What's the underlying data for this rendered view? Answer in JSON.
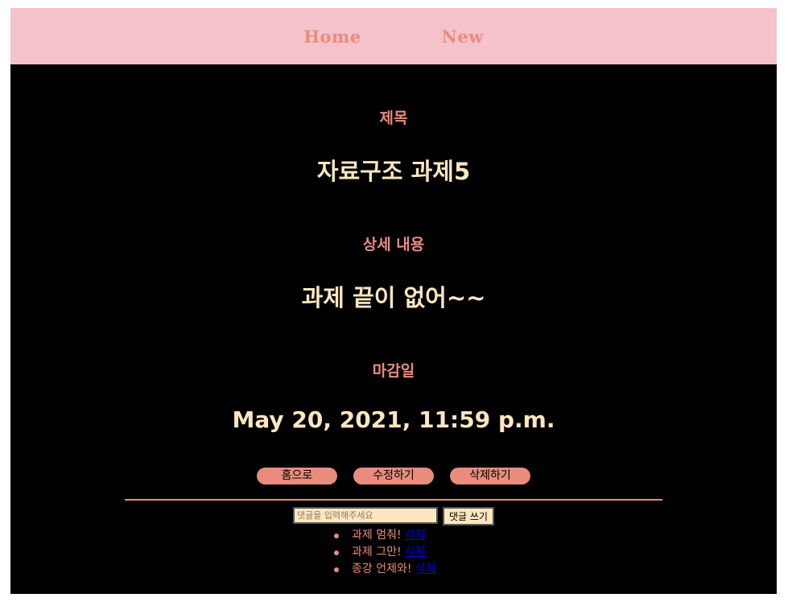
{
  "nav": {
    "home_label": "Home",
    "new_label": "New"
  },
  "detail": {
    "title_label": "제목",
    "title_value": "자료구조 과제5",
    "content_label": "상세 내용",
    "content_value": "과제 끝이 없어~~",
    "deadline_label": "마감일",
    "deadline_value": "May 20, 2021, 11:59 p.m."
  },
  "actions": {
    "home_button": "홈으로",
    "edit_button": "수정하기",
    "delete_button": "삭제하기"
  },
  "comment_form": {
    "placeholder": "댓글을 입력해주세요",
    "submit_label": "댓글 쓰기"
  },
  "comments": [
    {
      "text": "과제 멈춰!",
      "delete_label": "삭제"
    },
    {
      "text": "과제 그만!",
      "delete_label": "삭제"
    },
    {
      "text": "종강 언제와!",
      "delete_label": "삭제"
    }
  ],
  "colors": {
    "nav_background": "#f4c2ca",
    "accent": "#e98c7d",
    "value_text": "#fde7c0",
    "page_background": "#000000"
  }
}
